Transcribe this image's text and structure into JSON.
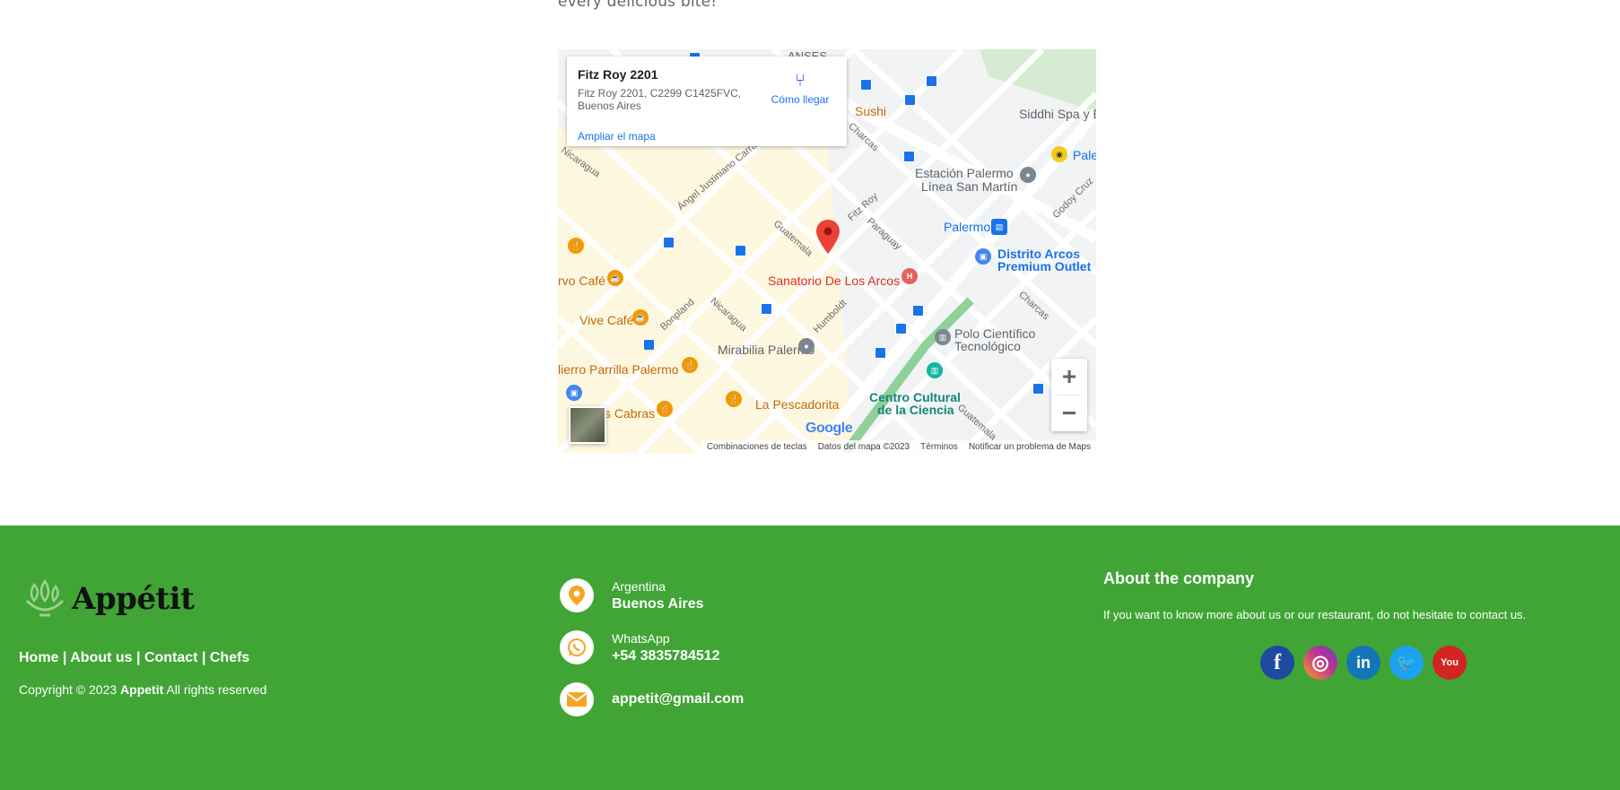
{
  "intro": {
    "text": "every delicious bite!"
  },
  "map": {
    "infocard": {
      "title": "Fitz Roy 2201",
      "address": "Fitz Roy 2201, C2299 C1425FVC, Buenos Aires",
      "directions_label": "Cómo llegar",
      "enlarge_label": "Ampliar el mapa"
    },
    "labels": {
      "anses": "ANSES",
      "sushi": "Sushi",
      "siddhi": "Siddhi Spa y E",
      "estacion": "Estación Palermo",
      "linea": "Línea San Martín",
      "palermo": "Palermo",
      "pale": "Pale",
      "distrito": "Distrito Arcos",
      "outlet": "Premium Outlet",
      "sanatorio": "Sanatorio De Los Arcos",
      "rvo_cafe": "rvo Café",
      "vive_cafe": "Vive Café",
      "mirabilia": "Mirabilia Palermo",
      "polo1": "Polo Científico",
      "polo2": "Tecnológico",
      "lierro": "lierro Parrilla Palermo",
      "centro1": "Centro Cultural",
      "centro2": "de la Ciencia",
      "pescadorita": "La Pescadorita",
      "cabras": "s Cabras"
    },
    "streets": {
      "nicaragua": "Nicaragua",
      "angel": "Ángel Justiniano Carranza",
      "charcas": "Charcas",
      "fitzroy": "Fitz Roy",
      "guatemala": "Guatemala",
      "paraguay": "Paraguay",
      "godoycruz": "Godoy Cruz",
      "bonpland": "Bonpland",
      "nicaragua2": "Nicaragua",
      "humboldt": "Humboldt",
      "charcas2": "Charcas",
      "guatemala2": "Guatemala"
    },
    "google": "Google",
    "attribution": [
      "Combinaciones de teclas",
      "Datos del mapa ©2023",
      "Términos",
      "Notificar un problema de Maps"
    ]
  },
  "footer": {
    "brand": "Appétit",
    "nav": [
      "Home",
      "About us",
      "Contact",
      "Chefs"
    ],
    "copyright_prefix": "Copyright © 2023",
    "copyright_brand": "Appetit",
    "copyright_suffix": "All rights reserved",
    "contact": {
      "country": "Argentina",
      "city": "Buenos Aires",
      "whatsapp_label": "WhatsApp",
      "phone": "+54 3835784512",
      "email": "appetit@gmail.com"
    },
    "about_title": "About the company",
    "about_text": "If you want to know more about us or our restaurant, do not hesitate to contact us.",
    "socials": [
      {
        "name": "facebook",
        "glyph": "f",
        "color": "#1e4ba0"
      },
      {
        "name": "instagram",
        "glyph": "◎",
        "color": "#c1358f"
      },
      {
        "name": "linkedin",
        "glyph": "in",
        "color": "#1476b6"
      },
      {
        "name": "twitter",
        "glyph": "🐦",
        "color": "#1da1f2"
      },
      {
        "name": "youtube",
        "glyph": "You",
        "color": "#d32323"
      }
    ],
    "colors": {
      "background": "#40a535",
      "icon_accent": "#f5a623"
    }
  }
}
